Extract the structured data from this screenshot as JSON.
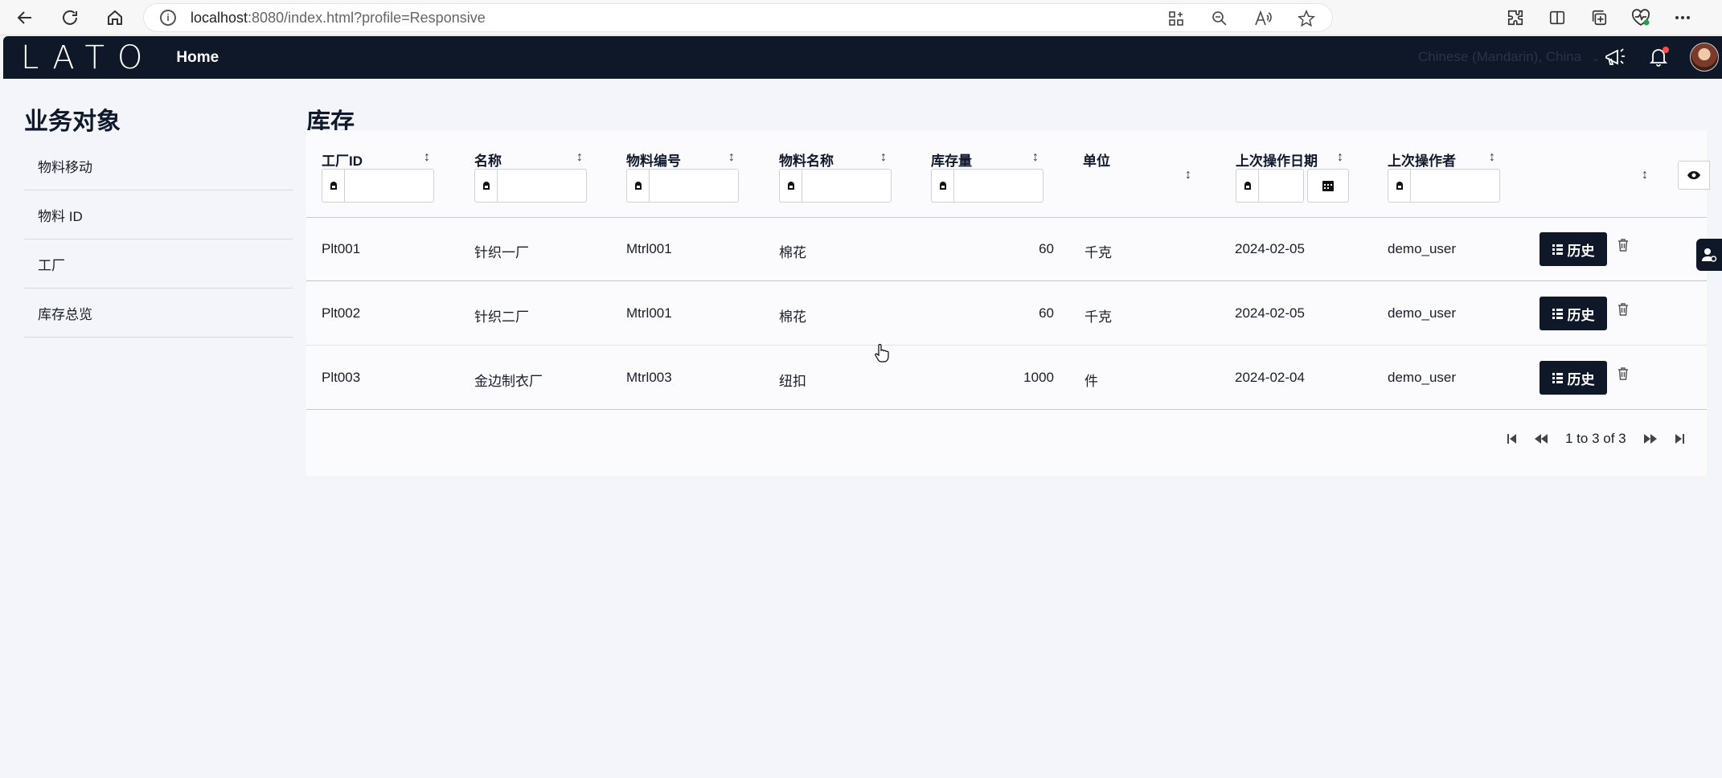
{
  "browser": {
    "url_host": "localhost",
    "url_rest": ":8080/index.html?profile=Responsive"
  },
  "header": {
    "logo": "LATO",
    "home": "Home",
    "language": "Chinese (Mandarin), China"
  },
  "sidebar": {
    "title": "业务对象",
    "items": [
      {
        "label": "物料移动"
      },
      {
        "label": "物料 ID"
      },
      {
        "label": "工厂"
      },
      {
        "label": "库存总览"
      }
    ]
  },
  "main": {
    "title": "库存",
    "columns": [
      {
        "label": "工厂ID"
      },
      {
        "label": "名称"
      },
      {
        "label": "物料编号"
      },
      {
        "label": "物料名称"
      },
      {
        "label": "库存量"
      },
      {
        "label": "单位"
      },
      {
        "label": "上次操作日期"
      },
      {
        "label": "上次操作者"
      }
    ],
    "rows": [
      {
        "plant_id": "Plt001",
        "name": "针织一厂",
        "material_no": "Mtrl001",
        "material_name": "棉花",
        "qty": "60",
        "unit": "千克",
        "last_date": "2024-02-05",
        "last_user": "demo_user"
      },
      {
        "plant_id": "Plt002",
        "name": "针织二厂",
        "material_no": "Mtrl001",
        "material_name": "棉花",
        "qty": "60",
        "unit": "千克",
        "last_date": "2024-02-05",
        "last_user": "demo_user"
      },
      {
        "plant_id": "Plt003",
        "name": "金边制衣厂",
        "material_no": "Mtrl003",
        "material_name": "纽扣",
        "qty": "1000",
        "unit": "件",
        "last_date": "2024-02-04",
        "last_user": "demo_user"
      }
    ],
    "history_label": "历史",
    "pager_text": "1 to 3 of 3"
  },
  "icons": {
    "sort": "sort-icon",
    "filter": "filter-icon",
    "calendar": "calendar-icon",
    "eye": "eye-icon",
    "trash": "trash-icon",
    "grid": "grid-icon"
  },
  "colors": {
    "header_bg": "#0f1829",
    "button_bg": "#0f1829",
    "page_bg": "#f4f5fa"
  }
}
